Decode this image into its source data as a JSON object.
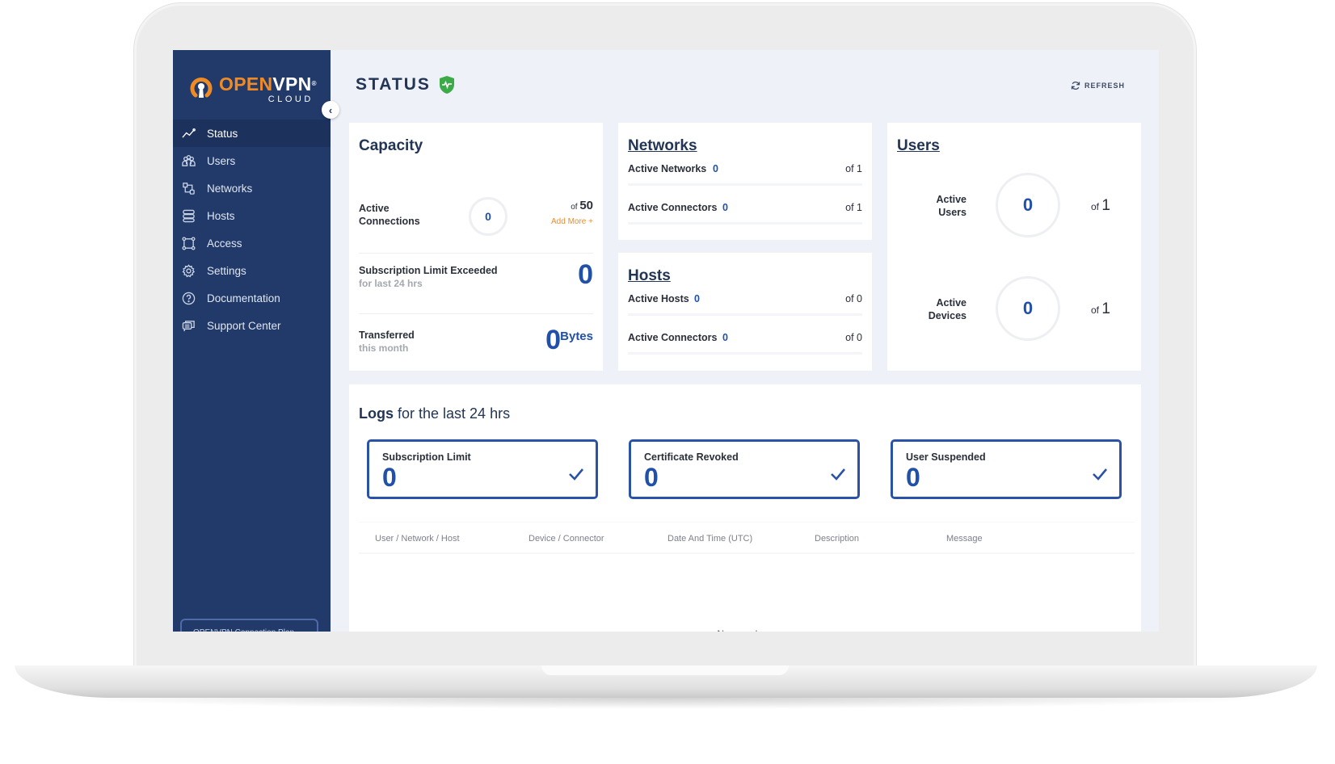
{
  "brand": {
    "open": "OPEN",
    "vpn": "VPN",
    "reg": "®",
    "cloud": "CLOUD",
    "accent": "#f08a24",
    "navy": "#223a69"
  },
  "sidebar": {
    "collapse_icon": "chevron-left-icon",
    "items": [
      {
        "label": "Status",
        "icon": "trend-line-icon",
        "active": true
      },
      {
        "label": "Users",
        "icon": "users-icon"
      },
      {
        "label": "Networks",
        "icon": "networks-icon"
      },
      {
        "label": "Hosts",
        "icon": "hosts-icon"
      },
      {
        "label": "Access",
        "icon": "access-icon"
      },
      {
        "label": "Settings",
        "icon": "gear-icon"
      },
      {
        "label": "Documentation",
        "icon": "help-circle-icon"
      },
      {
        "label": "Support Center",
        "icon": "chat-icon"
      }
    ],
    "bottom_button": "OPENVPN Connection Plan"
  },
  "header": {
    "title": "STATUS",
    "status_icon": "shield-pulse-icon",
    "refresh_label": "REFRESH"
  },
  "capacity": {
    "title": "Capacity",
    "active_connections": {
      "label_1": "Active",
      "label_2": "Connections",
      "value": "0",
      "of_label": "of",
      "max": "50",
      "add_more": "Add More +"
    },
    "subscription": {
      "label": "Subscription Limit Exceeded",
      "sub": "for last 24 hrs",
      "value": "0"
    },
    "transferred": {
      "label": "Transferred",
      "sub": "this month",
      "value": "0",
      "unit": "Bytes"
    }
  },
  "networks": {
    "title": "Networks",
    "rows": [
      {
        "label": "Active Networks",
        "value": "0",
        "of": "of 1"
      },
      {
        "label": "Active Connectors",
        "value": "0",
        "of": "of 1"
      }
    ]
  },
  "hosts": {
    "title": "Hosts",
    "rows": [
      {
        "label": "Active Hosts",
        "value": "0",
        "of": "of 0"
      },
      {
        "label": "Active Connectors",
        "value": "0",
        "of": "of 0"
      }
    ]
  },
  "users": {
    "title": "Users",
    "rows": [
      {
        "label_1": "Active",
        "label_2": "Users",
        "value": "0",
        "of_label": "of",
        "max": "1"
      },
      {
        "label_1": "Active",
        "label_2": "Devices",
        "value": "0",
        "of_label": "of",
        "max": "1"
      }
    ]
  },
  "logs": {
    "title_bold": "Logs",
    "title_rest": " for the last 24 hrs",
    "boxes": [
      {
        "label": "Subscription Limit",
        "value": "0"
      },
      {
        "label": "Certificate Revoked",
        "value": "0"
      },
      {
        "label": "User Suspended",
        "value": "0"
      }
    ],
    "columns": [
      "User / Network / Host",
      "Device / Connector",
      "Date And Time (UTC)",
      "Description",
      "Message"
    ],
    "empty": "No error logs"
  }
}
